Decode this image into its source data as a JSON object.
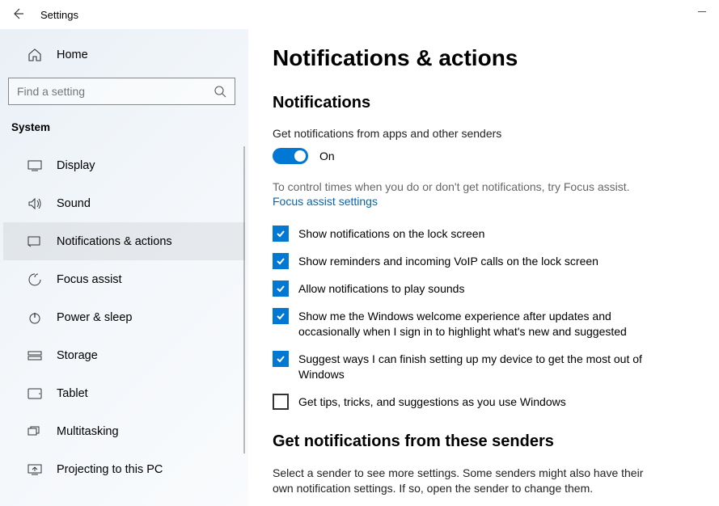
{
  "titlebar": {
    "title": "Settings"
  },
  "sidebar": {
    "home_label": "Home",
    "search_placeholder": "Find a setting",
    "category_label": "System",
    "items": [
      {
        "label": "Display",
        "icon": "display-icon"
      },
      {
        "label": "Sound",
        "icon": "sound-icon"
      },
      {
        "label": "Notifications & actions",
        "icon": "notifications-icon",
        "selected": true
      },
      {
        "label": "Focus assist",
        "icon": "focus-assist-icon"
      },
      {
        "label": "Power & sleep",
        "icon": "power-icon"
      },
      {
        "label": "Storage",
        "icon": "storage-icon"
      },
      {
        "label": "Tablet",
        "icon": "tablet-icon"
      },
      {
        "label": "Multitasking",
        "icon": "multitasking-icon"
      },
      {
        "label": "Projecting to this PC",
        "icon": "projecting-icon"
      }
    ]
  },
  "content": {
    "page_title": "Notifications & actions",
    "section1_title": "Notifications",
    "get_notifications_label": "Get notifications from apps and other senders",
    "toggle_state": "On",
    "help_text": "To control times when you do or don't get notifications, try Focus assist.",
    "focus_assist_link": "Focus assist settings",
    "checkboxes": [
      {
        "label": "Show notifications on the lock screen",
        "checked": true
      },
      {
        "label": "Show reminders and incoming VoIP calls on the lock screen",
        "checked": true
      },
      {
        "label": "Allow notifications to play sounds",
        "checked": true
      },
      {
        "label": "Show me the Windows welcome experience after updates and occasionally when I sign in to highlight what's new and suggested",
        "checked": true
      },
      {
        "label": "Suggest ways I can finish setting up my device to get the most out of Windows",
        "checked": true
      },
      {
        "label": "Get tips, tricks, and suggestions as you use Windows",
        "checked": false
      }
    ],
    "section2_title": "Get notifications from these senders",
    "senders_desc": "Select a sender to see more settings. Some senders might also have their own notification settings. If so, open the sender to change them."
  }
}
